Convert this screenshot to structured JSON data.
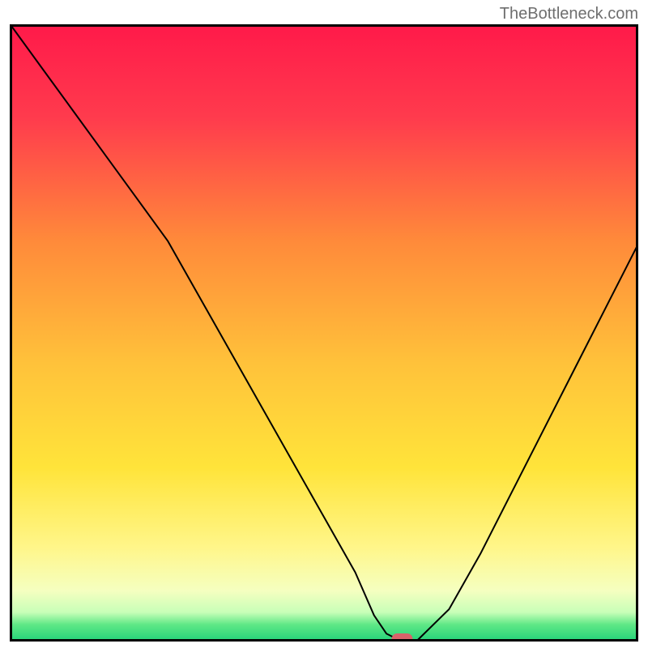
{
  "watermark": "TheBottleneck.com",
  "chart_data": {
    "type": "line",
    "title": "",
    "xlabel": "",
    "ylabel": "",
    "xlim": [
      0,
      100
    ],
    "ylim": [
      0,
      100
    ],
    "x": [
      0,
      5,
      10,
      15,
      20,
      25,
      30,
      35,
      40,
      45,
      50,
      55,
      58,
      60,
      62,
      65,
      70,
      75,
      80,
      85,
      90,
      95,
      100
    ],
    "values": [
      100,
      93,
      86,
      79,
      72,
      65,
      56,
      47,
      38,
      29,
      20,
      11,
      4,
      1,
      0,
      0,
      5,
      14,
      24,
      34,
      44,
      54,
      64
    ],
    "note": "V-shaped bottleneck curve with minimum near x≈62; background is vertical gradient red→orange→yellow→pale-yellow→thin green band at bottom; red pill marker at the minimum point.",
    "marker": {
      "x": 62.5,
      "y": 0
    },
    "gradient_stops": [
      {
        "offset": 0.0,
        "color": "#ff1a4a"
      },
      {
        "offset": 0.15,
        "color": "#ff3b4d"
      },
      {
        "offset": 0.35,
        "color": "#ff8a3a"
      },
      {
        "offset": 0.55,
        "color": "#ffc23a"
      },
      {
        "offset": 0.72,
        "color": "#ffe43a"
      },
      {
        "offset": 0.85,
        "color": "#fff68a"
      },
      {
        "offset": 0.92,
        "color": "#f5ffc0"
      },
      {
        "offset": 0.955,
        "color": "#c8ffb8"
      },
      {
        "offset": 0.975,
        "color": "#5fe886"
      },
      {
        "offset": 1.0,
        "color": "#28d47a"
      }
    ]
  }
}
